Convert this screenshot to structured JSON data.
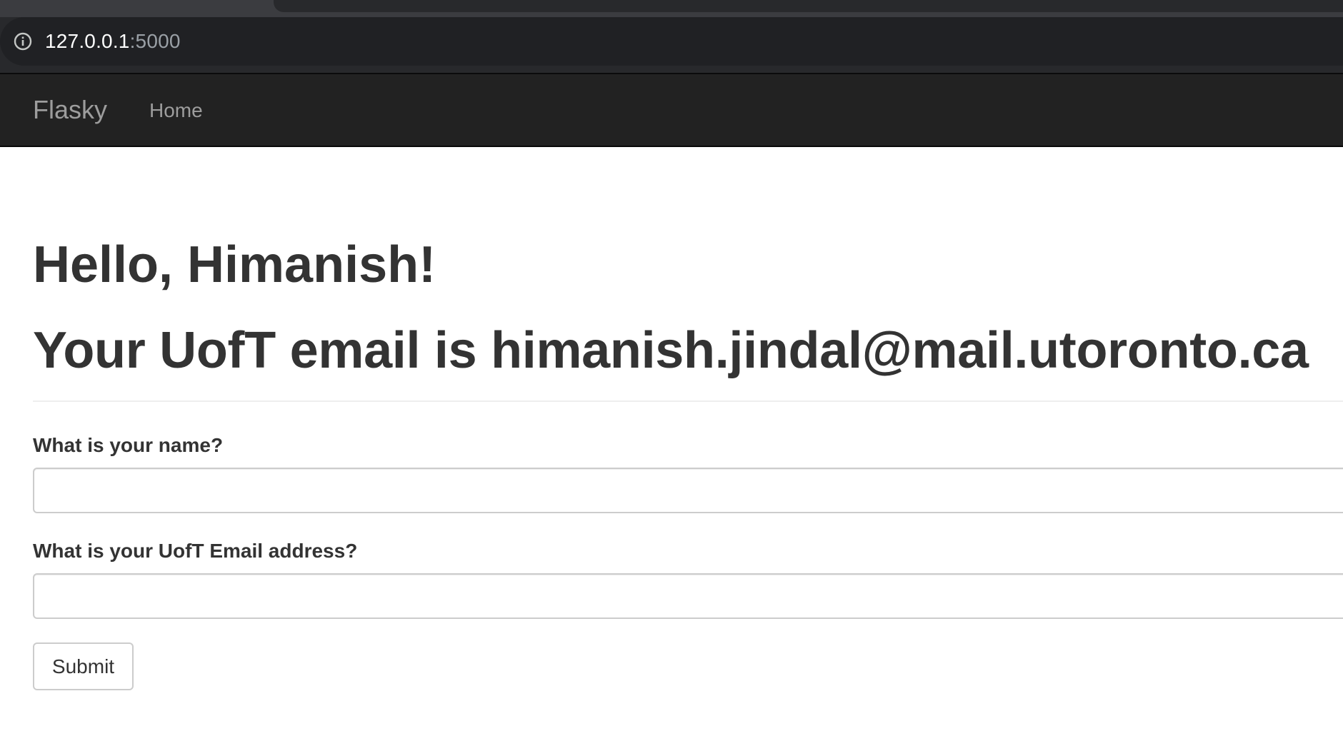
{
  "browser": {
    "url_host": "127.0.0.1",
    "url_port": ":5000",
    "info_icon": "info-circle-icon"
  },
  "navbar": {
    "brand": "Flasky",
    "links": [
      {
        "label": "Home"
      }
    ]
  },
  "page": {
    "greeting": "Hello, Himanish!",
    "email_message": "Your UofT email is himanish.jindal@mail.utoronto.ca"
  },
  "form": {
    "name_label": "What is your name?",
    "name_value": "",
    "email_label": "What is your UofT Email address?",
    "email_value": "",
    "submit_label": "Submit"
  },
  "colors": {
    "navbar_bg": "#222222",
    "navbar_text": "#9d9d9d",
    "body_text": "#333333",
    "input_border": "#cccccc",
    "chrome_bg": "#202124"
  }
}
